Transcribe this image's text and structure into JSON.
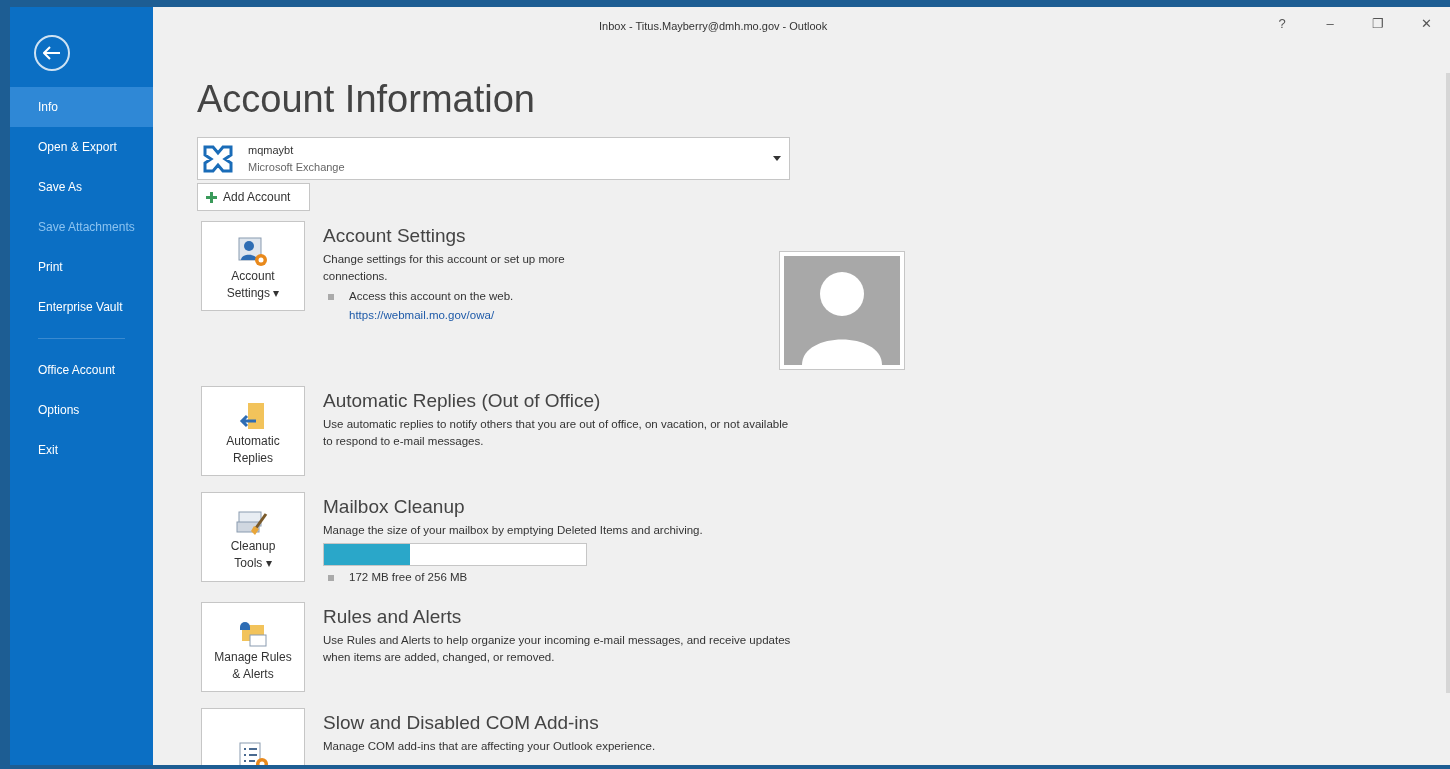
{
  "window": {
    "title": "Inbox - Titus.Mayberry@dmh.mo.gov - Outlook",
    "controls": [
      "?",
      "–",
      "❐",
      "✕"
    ]
  },
  "sidebar": {
    "items": [
      {
        "kind": "item",
        "label": "Info",
        "selected": true,
        "disabled": false
      },
      {
        "kind": "item",
        "label": "Open & Export",
        "selected": false,
        "disabled": false
      },
      {
        "kind": "item",
        "label": "Save As",
        "selected": false,
        "disabled": false
      },
      {
        "kind": "item",
        "label": "Save Attachments",
        "selected": false,
        "disabled": true
      },
      {
        "kind": "item",
        "label": "Print",
        "selected": false,
        "disabled": false
      },
      {
        "kind": "item",
        "label": "Enterprise Vault",
        "selected": false,
        "disabled": false
      },
      {
        "kind": "separator"
      },
      {
        "kind": "item",
        "label": "Office Account",
        "selected": false,
        "disabled": false
      },
      {
        "kind": "item",
        "label": "Options",
        "selected": false,
        "disabled": false
      },
      {
        "kind": "item",
        "label": "Exit",
        "selected": false,
        "disabled": false
      }
    ]
  },
  "heading": "Account Information",
  "account": {
    "name": "mqmaybt",
    "type": "Microsoft Exchange"
  },
  "add_account": "Add Account",
  "sections": [
    {
      "kind": "account",
      "button": [
        "Account",
        "Settings ▾"
      ],
      "title": "Account Settings",
      "description": "Change settings for this account or set up more connections.",
      "bullet": "Access this account on the web.",
      "link": "https://webmail.mo.gov/owa/",
      "photo": true
    },
    {
      "kind": "replies",
      "button": [
        "Automatic",
        "Replies"
      ],
      "title": "Automatic Replies (Out of Office)",
      "description": "Use automatic replies to notify others that you are out of office, on vacation, or not available to respond to e-mail messages."
    },
    {
      "kind": "cleanup",
      "button": [
        "Cleanup",
        "Tools ▾"
      ],
      "title": "Mailbox Cleanup",
      "description": "Manage the size of your mailbox by emptying Deleted Items and archiving.",
      "level": 0.33,
      "bullet": "172 MB free of 256 MB"
    },
    {
      "kind": "rules",
      "button": [
        "Manage Rules",
        "& Alerts"
      ],
      "title": "Rules and Alerts",
      "description": "Use Rules and Alerts to help organize your incoming e-mail messages, and receive updates when items are added, changed, or removed."
    },
    {
      "kind": "addins",
      "title": "Slow and Disabled COM Add-ins",
      "description": "Manage COM add-ins that are affecting your Outlook experience."
    }
  ]
}
